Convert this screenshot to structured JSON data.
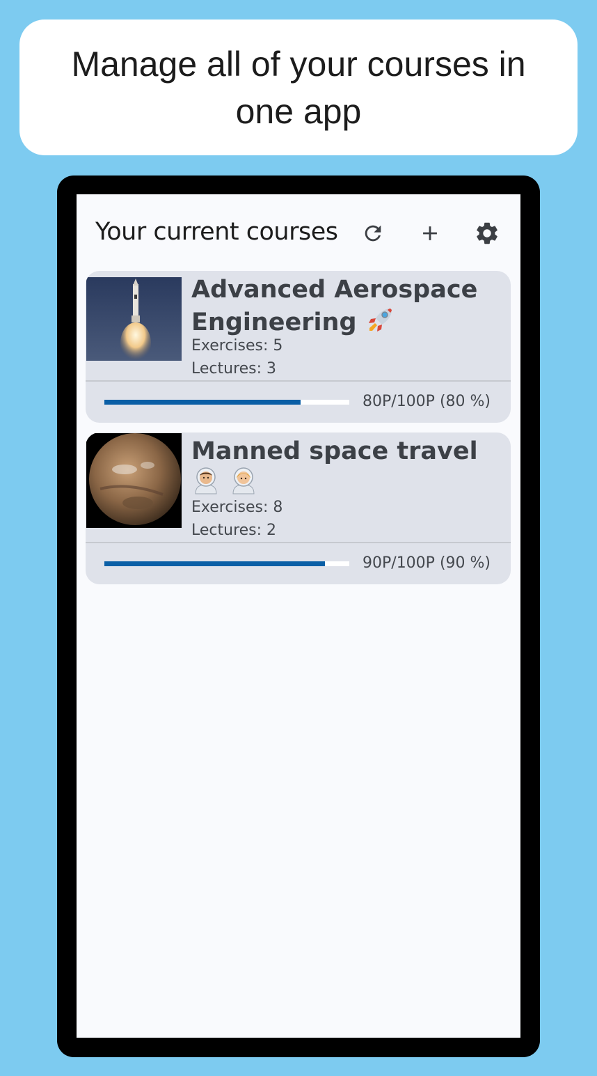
{
  "banner": {
    "text": "Manage all of your courses in one app"
  },
  "appbar": {
    "title": "Your current courses",
    "actions": [
      {
        "icon": "refresh-icon"
      },
      {
        "icon": "plus-icon"
      },
      {
        "icon": "gear-icon"
      }
    ]
  },
  "courses": [
    {
      "title": "Advanced Aerospace Engineering",
      "emoji": "rocket",
      "exercises": "Exercises: 5",
      "lectures": "Lectures: 3",
      "points": "80P/100P (80 %)",
      "progress": 0.8,
      "image": "rocket-launch"
    },
    {
      "title": "Manned space travel",
      "emoji": "astronauts",
      "exercises": "Exercises: 8",
      "lectures": "Lectures: 2",
      "points": "90P/100P (90 %)",
      "progress": 0.9,
      "image": "mars-planet"
    }
  ],
  "colors": {
    "background": "#7dcbf0",
    "card": "#dfe2ea",
    "progress": "#0a5fa6",
    "screen": "#f9fafd"
  }
}
